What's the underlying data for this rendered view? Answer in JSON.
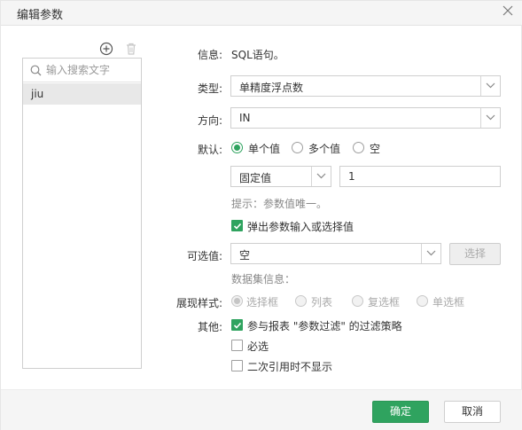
{
  "dialog": {
    "title": "编辑参数"
  },
  "left": {
    "search_placeholder": "输入搜索文字",
    "items": [
      {
        "label": "jiu"
      }
    ]
  },
  "form": {
    "info": {
      "label": "信息:",
      "value": "SQL语句。"
    },
    "type": {
      "label": "类型:",
      "value": "单精度浮点数"
    },
    "direction": {
      "label": "方向:",
      "value": "IN"
    },
    "default": {
      "label": "默认:",
      "options": [
        "单个值",
        "多个值",
        "空"
      ],
      "selected": "单个值",
      "mode_value": "固定值",
      "input_value": "1",
      "hint": "提示：参数值唯一。",
      "popup_label": "弹出参数输入或选择值",
      "popup_checked": true
    },
    "optional": {
      "label": "可选值:",
      "value": "空",
      "button": "选择",
      "dataset_info": "数据集信息："
    },
    "display_style": {
      "label": "展现样式:",
      "options": [
        "选择框",
        "列表",
        "复选框",
        "单选框"
      ],
      "selected": "选择框"
    },
    "other": {
      "label": "其他:",
      "items": [
        {
          "label": "参与报表 \"参数过滤\" 的过滤策略",
          "checked": true
        },
        {
          "label": "必选",
          "checked": false
        },
        {
          "label": "二次引用时不显示",
          "checked": false
        }
      ]
    }
  },
  "footer": {
    "ok": "确定",
    "cancel": "取消"
  },
  "colors": {
    "accent": "#2fa35f",
    "header_bg": "#f5f5f5",
    "border": "#cfcfcf"
  }
}
